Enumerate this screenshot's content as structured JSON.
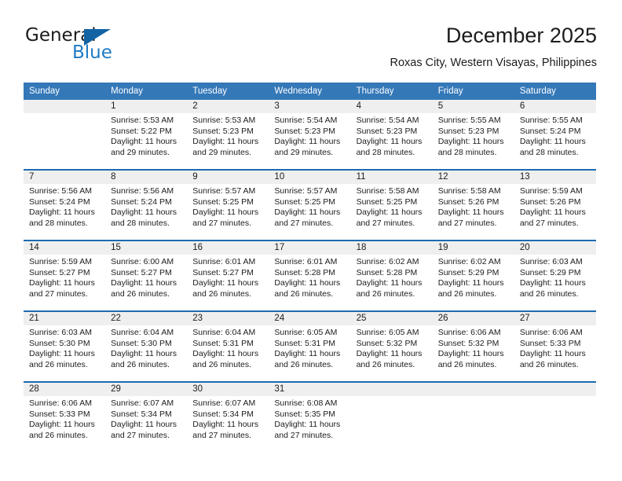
{
  "logo": {
    "word1": "General",
    "word2": "Blue",
    "accent_color": "#1264a4"
  },
  "header": {
    "title": "December 2025",
    "location": "Roxas City, Western Visayas, Philippines"
  },
  "calendar": {
    "header_bg": "#3478b8",
    "daynum_bg": "#efefef",
    "separator_color": "#1d6bb0",
    "weekdays": [
      "Sunday",
      "Monday",
      "Tuesday",
      "Wednesday",
      "Thursday",
      "Friday",
      "Saturday"
    ],
    "weeks": [
      [
        {
          "day": "",
          "sunrise": "",
          "sunset": "",
          "daylight1": "",
          "daylight2": ""
        },
        {
          "day": "1",
          "sunrise": "Sunrise: 5:53 AM",
          "sunset": "Sunset: 5:22 PM",
          "daylight1": "Daylight: 11 hours",
          "daylight2": "and 29 minutes."
        },
        {
          "day": "2",
          "sunrise": "Sunrise: 5:53 AM",
          "sunset": "Sunset: 5:23 PM",
          "daylight1": "Daylight: 11 hours",
          "daylight2": "and 29 minutes."
        },
        {
          "day": "3",
          "sunrise": "Sunrise: 5:54 AM",
          "sunset": "Sunset: 5:23 PM",
          "daylight1": "Daylight: 11 hours",
          "daylight2": "and 29 minutes."
        },
        {
          "day": "4",
          "sunrise": "Sunrise: 5:54 AM",
          "sunset": "Sunset: 5:23 PM",
          "daylight1": "Daylight: 11 hours",
          "daylight2": "and 28 minutes."
        },
        {
          "day": "5",
          "sunrise": "Sunrise: 5:55 AM",
          "sunset": "Sunset: 5:23 PM",
          "daylight1": "Daylight: 11 hours",
          "daylight2": "and 28 minutes."
        },
        {
          "day": "6",
          "sunrise": "Sunrise: 5:55 AM",
          "sunset": "Sunset: 5:24 PM",
          "daylight1": "Daylight: 11 hours",
          "daylight2": "and 28 minutes."
        }
      ],
      [
        {
          "day": "7",
          "sunrise": "Sunrise: 5:56 AM",
          "sunset": "Sunset: 5:24 PM",
          "daylight1": "Daylight: 11 hours",
          "daylight2": "and 28 minutes."
        },
        {
          "day": "8",
          "sunrise": "Sunrise: 5:56 AM",
          "sunset": "Sunset: 5:24 PM",
          "daylight1": "Daylight: 11 hours",
          "daylight2": "and 28 minutes."
        },
        {
          "day": "9",
          "sunrise": "Sunrise: 5:57 AM",
          "sunset": "Sunset: 5:25 PM",
          "daylight1": "Daylight: 11 hours",
          "daylight2": "and 27 minutes."
        },
        {
          "day": "10",
          "sunrise": "Sunrise: 5:57 AM",
          "sunset": "Sunset: 5:25 PM",
          "daylight1": "Daylight: 11 hours",
          "daylight2": "and 27 minutes."
        },
        {
          "day": "11",
          "sunrise": "Sunrise: 5:58 AM",
          "sunset": "Sunset: 5:25 PM",
          "daylight1": "Daylight: 11 hours",
          "daylight2": "and 27 minutes."
        },
        {
          "day": "12",
          "sunrise": "Sunrise: 5:58 AM",
          "sunset": "Sunset: 5:26 PM",
          "daylight1": "Daylight: 11 hours",
          "daylight2": "and 27 minutes."
        },
        {
          "day": "13",
          "sunrise": "Sunrise: 5:59 AM",
          "sunset": "Sunset: 5:26 PM",
          "daylight1": "Daylight: 11 hours",
          "daylight2": "and 27 minutes."
        }
      ],
      [
        {
          "day": "14",
          "sunrise": "Sunrise: 5:59 AM",
          "sunset": "Sunset: 5:27 PM",
          "daylight1": "Daylight: 11 hours",
          "daylight2": "and 27 minutes."
        },
        {
          "day": "15",
          "sunrise": "Sunrise: 6:00 AM",
          "sunset": "Sunset: 5:27 PM",
          "daylight1": "Daylight: 11 hours",
          "daylight2": "and 26 minutes."
        },
        {
          "day": "16",
          "sunrise": "Sunrise: 6:01 AM",
          "sunset": "Sunset: 5:27 PM",
          "daylight1": "Daylight: 11 hours",
          "daylight2": "and 26 minutes."
        },
        {
          "day": "17",
          "sunrise": "Sunrise: 6:01 AM",
          "sunset": "Sunset: 5:28 PM",
          "daylight1": "Daylight: 11 hours",
          "daylight2": "and 26 minutes."
        },
        {
          "day": "18",
          "sunrise": "Sunrise: 6:02 AM",
          "sunset": "Sunset: 5:28 PM",
          "daylight1": "Daylight: 11 hours",
          "daylight2": "and 26 minutes."
        },
        {
          "day": "19",
          "sunrise": "Sunrise: 6:02 AM",
          "sunset": "Sunset: 5:29 PM",
          "daylight1": "Daylight: 11 hours",
          "daylight2": "and 26 minutes."
        },
        {
          "day": "20",
          "sunrise": "Sunrise: 6:03 AM",
          "sunset": "Sunset: 5:29 PM",
          "daylight1": "Daylight: 11 hours",
          "daylight2": "and 26 minutes."
        }
      ],
      [
        {
          "day": "21",
          "sunrise": "Sunrise: 6:03 AM",
          "sunset": "Sunset: 5:30 PM",
          "daylight1": "Daylight: 11 hours",
          "daylight2": "and 26 minutes."
        },
        {
          "day": "22",
          "sunrise": "Sunrise: 6:04 AM",
          "sunset": "Sunset: 5:30 PM",
          "daylight1": "Daylight: 11 hours",
          "daylight2": "and 26 minutes."
        },
        {
          "day": "23",
          "sunrise": "Sunrise: 6:04 AM",
          "sunset": "Sunset: 5:31 PM",
          "daylight1": "Daylight: 11 hours",
          "daylight2": "and 26 minutes."
        },
        {
          "day": "24",
          "sunrise": "Sunrise: 6:05 AM",
          "sunset": "Sunset: 5:31 PM",
          "daylight1": "Daylight: 11 hours",
          "daylight2": "and 26 minutes."
        },
        {
          "day": "25",
          "sunrise": "Sunrise: 6:05 AM",
          "sunset": "Sunset: 5:32 PM",
          "daylight1": "Daylight: 11 hours",
          "daylight2": "and 26 minutes."
        },
        {
          "day": "26",
          "sunrise": "Sunrise: 6:06 AM",
          "sunset": "Sunset: 5:32 PM",
          "daylight1": "Daylight: 11 hours",
          "daylight2": "and 26 minutes."
        },
        {
          "day": "27",
          "sunrise": "Sunrise: 6:06 AM",
          "sunset": "Sunset: 5:33 PM",
          "daylight1": "Daylight: 11 hours",
          "daylight2": "and 26 minutes."
        }
      ],
      [
        {
          "day": "28",
          "sunrise": "Sunrise: 6:06 AM",
          "sunset": "Sunset: 5:33 PM",
          "daylight1": "Daylight: 11 hours",
          "daylight2": "and 26 minutes."
        },
        {
          "day": "29",
          "sunrise": "Sunrise: 6:07 AM",
          "sunset": "Sunset: 5:34 PM",
          "daylight1": "Daylight: 11 hours",
          "daylight2": "and 27 minutes."
        },
        {
          "day": "30",
          "sunrise": "Sunrise: 6:07 AM",
          "sunset": "Sunset: 5:34 PM",
          "daylight1": "Daylight: 11 hours",
          "daylight2": "and 27 minutes."
        },
        {
          "day": "31",
          "sunrise": "Sunrise: 6:08 AM",
          "sunset": "Sunset: 5:35 PM",
          "daylight1": "Daylight: 11 hours",
          "daylight2": "and 27 minutes."
        },
        {
          "day": "",
          "sunrise": "",
          "sunset": "",
          "daylight1": "",
          "daylight2": ""
        },
        {
          "day": "",
          "sunrise": "",
          "sunset": "",
          "daylight1": "",
          "daylight2": ""
        },
        {
          "day": "",
          "sunrise": "",
          "sunset": "",
          "daylight1": "",
          "daylight2": ""
        }
      ]
    ]
  }
}
